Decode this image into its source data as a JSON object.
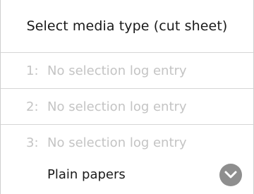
{
  "header": {
    "title": "Select media type (cut sheet)"
  },
  "log_entries": [
    {
      "index": "1:",
      "label": "No selection log entry"
    },
    {
      "index": "2:",
      "label": "No selection log entry"
    },
    {
      "index": "3:",
      "label": "No selection log entry"
    }
  ],
  "current_selection": {
    "label": "Plain papers",
    "icon": "chevron-down-icon"
  },
  "colors": {
    "disabled_text": "#c4c4c4",
    "text": "#1a1a1a",
    "chevron_bg": "#8e8e8e"
  }
}
